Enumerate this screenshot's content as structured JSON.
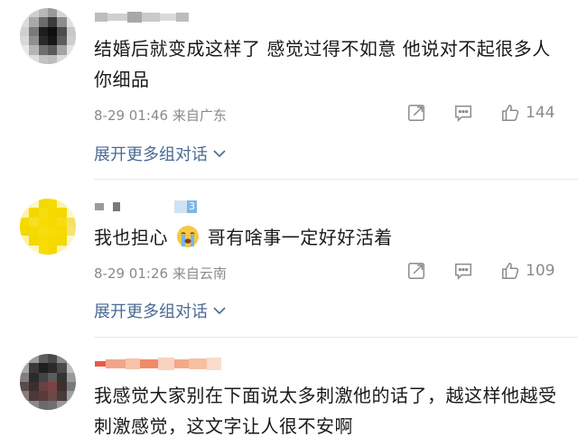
{
  "comments": [
    {
      "text": "结婚后就变成这样了 感觉过得不如意 他说对不起很多人 你细品",
      "time": "8-29 01:46",
      "location": "来自广东",
      "likes": "144",
      "expand_label": "展开更多组对话"
    },
    {
      "text_before": "我也担心",
      "text_after": "哥有啥事一定好好活着",
      "badge": "3",
      "time": "8-29 01:26",
      "location": "来自云南",
      "likes": "109",
      "expand_label": "展开更多组对话"
    },
    {
      "text": "我感觉大家别在下面说太多刺激他的话了，越这样他越受刺激感觉，这文字让人很不安啊"
    }
  ],
  "icons": [
    "share-icon",
    "comment-icon",
    "thumbs-up-icon",
    "chevron-down-icon",
    "crying-emoji-icon"
  ],
  "colors": {
    "meta": "#8a8a8a",
    "link": "#4a6a92",
    "text": "#1a1a1a"
  }
}
